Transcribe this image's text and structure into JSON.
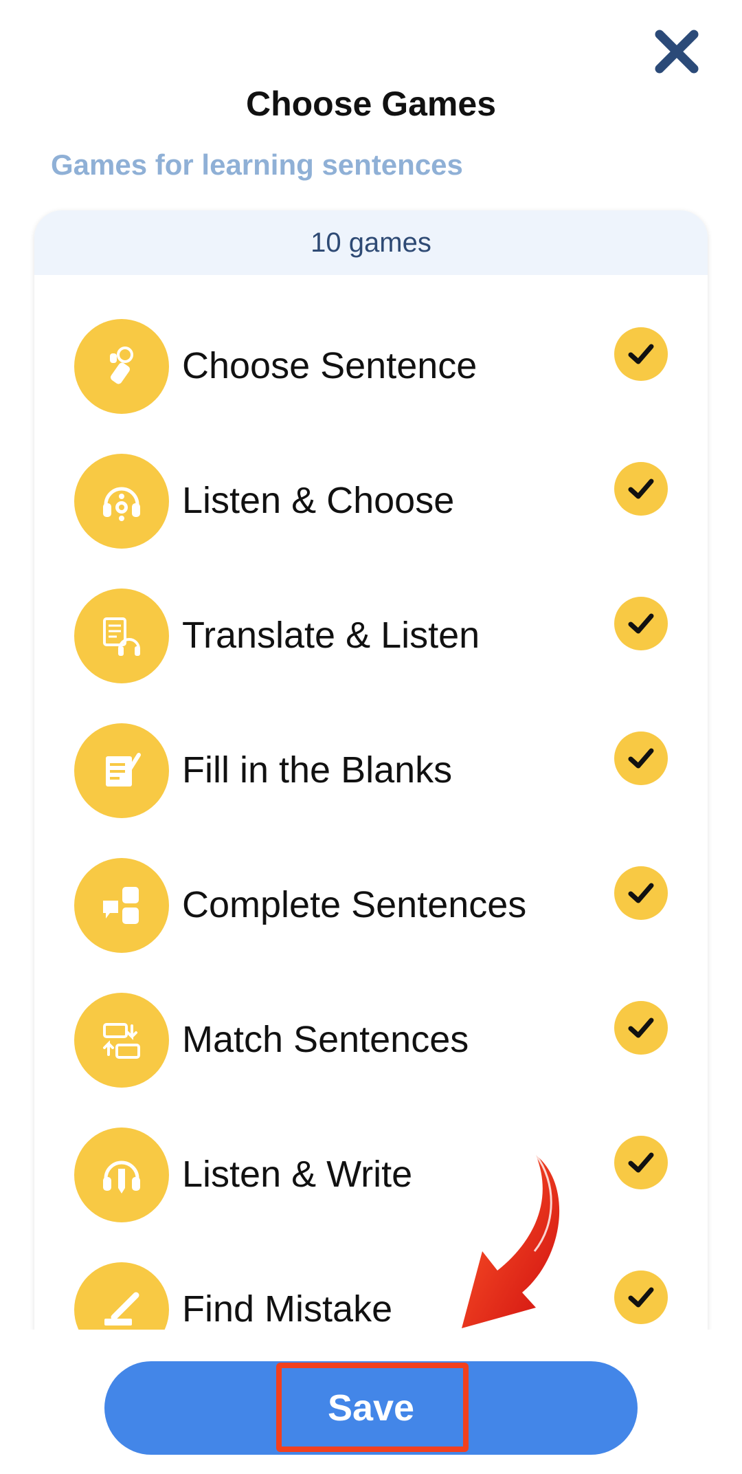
{
  "header": {
    "title": "Choose Games",
    "subtitle": "Games for learning sentences",
    "close_icon": "close-icon"
  },
  "card": {
    "count_label": "10 games"
  },
  "games": [
    {
      "label": "Choose Sentence",
      "icon": "pointing-hand-icon",
      "checked": true
    },
    {
      "label": "Listen & Choose",
      "icon": "headphones-icon",
      "checked": true
    },
    {
      "label": "Translate & Listen",
      "icon": "translate-listen-icon",
      "checked": true
    },
    {
      "label": "Fill in the Blanks",
      "icon": "fill-blanks-icon",
      "checked": true
    },
    {
      "label": "Complete Sentences",
      "icon": "puzzle-icon",
      "checked": true
    },
    {
      "label": "Match Sentences",
      "icon": "match-icon",
      "checked": true
    },
    {
      "label": "Listen & Write",
      "icon": "headphones-pen-icon",
      "checked": true
    },
    {
      "label": "Find Mistake",
      "icon": "pen-eraser-icon",
      "checked": true
    }
  ],
  "footer": {
    "save_label": "Save"
  },
  "colors": {
    "accent_yellow": "#f8c944",
    "save_blue": "#4386e8",
    "close_navy": "#2b4a78",
    "subtitle_blue": "#8fb0d6",
    "header_bg": "#eef4fc",
    "highlight_red": "#f2401e"
  }
}
